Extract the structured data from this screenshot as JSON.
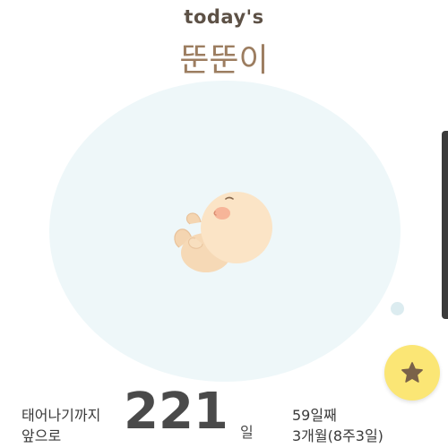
{
  "header": {
    "eyebrow": "today's",
    "baby_name": "뚠뚠이"
  },
  "countdown": {
    "label_line1": "태어나기까지",
    "label_line2": "앞으로",
    "days_left": "221",
    "unit": "일"
  },
  "pregnancy": {
    "day_count": "59일째",
    "age_text": "3개월(8주3일)"
  },
  "fab": {
    "icon": "star-icon"
  },
  "colors": {
    "eyebrow": "#5d5146",
    "name": "#9c7d60",
    "bubble": "#eef7f9",
    "fab": "#fbe675",
    "star": "#7a6249"
  }
}
